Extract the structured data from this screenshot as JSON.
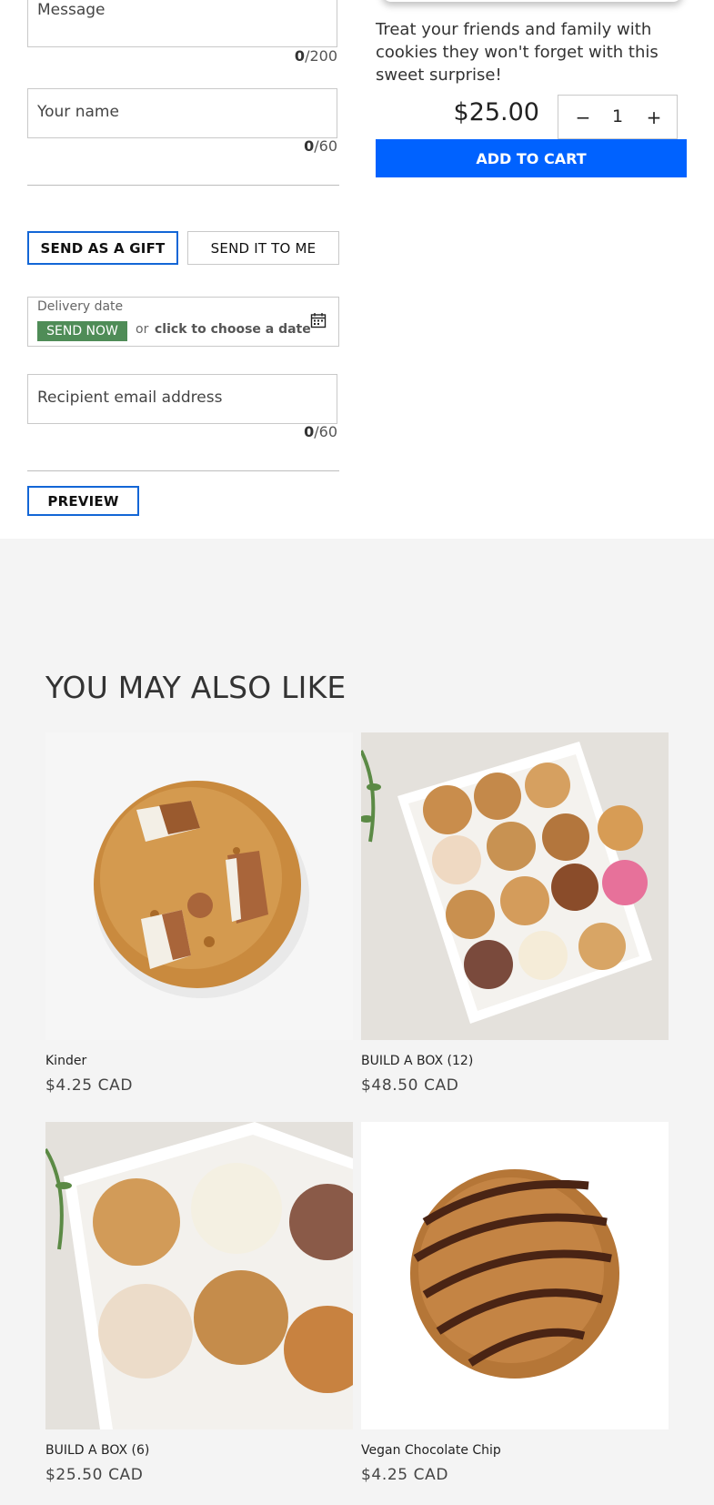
{
  "form": {
    "message_placeholder": "Message",
    "message_count": "0",
    "message_max": "/200",
    "name_placeholder": "Your name",
    "name_count": "0",
    "name_max": "/60",
    "send_gift_label": "SEND AS A GIFT",
    "send_me_label": "SEND IT TO ME",
    "delivery_label": "Delivery date",
    "send_now_label": "SEND NOW",
    "or_label": "or",
    "choose_date_label": "click to choose a date",
    "email_placeholder": "Recipient email address",
    "email_count": "0",
    "email_max": "/60",
    "preview_label": "PREVIEW"
  },
  "product": {
    "description": "Treat your friends and family with cookies they won't forget with this sweet surprise!",
    "price": "$25.00",
    "quantity": "1",
    "minus_label": "−",
    "plus_label": "+",
    "add_to_cart_label": "ADD TO CART",
    "accent_color": "#0062ff"
  },
  "recommendations": {
    "title": "YOU MAY ALSO LIKE",
    "items": [
      {
        "name": "Kinder",
        "price": "$4.25 CAD"
      },
      {
        "name": "BUILD A BOX (12)",
        "price": "$48.50 CAD"
      },
      {
        "name": "BUILD A BOX (6)",
        "price": "$25.50 CAD"
      },
      {
        "name": "Vegan Chocolate Chip",
        "price": "$4.25 CAD"
      }
    ]
  }
}
